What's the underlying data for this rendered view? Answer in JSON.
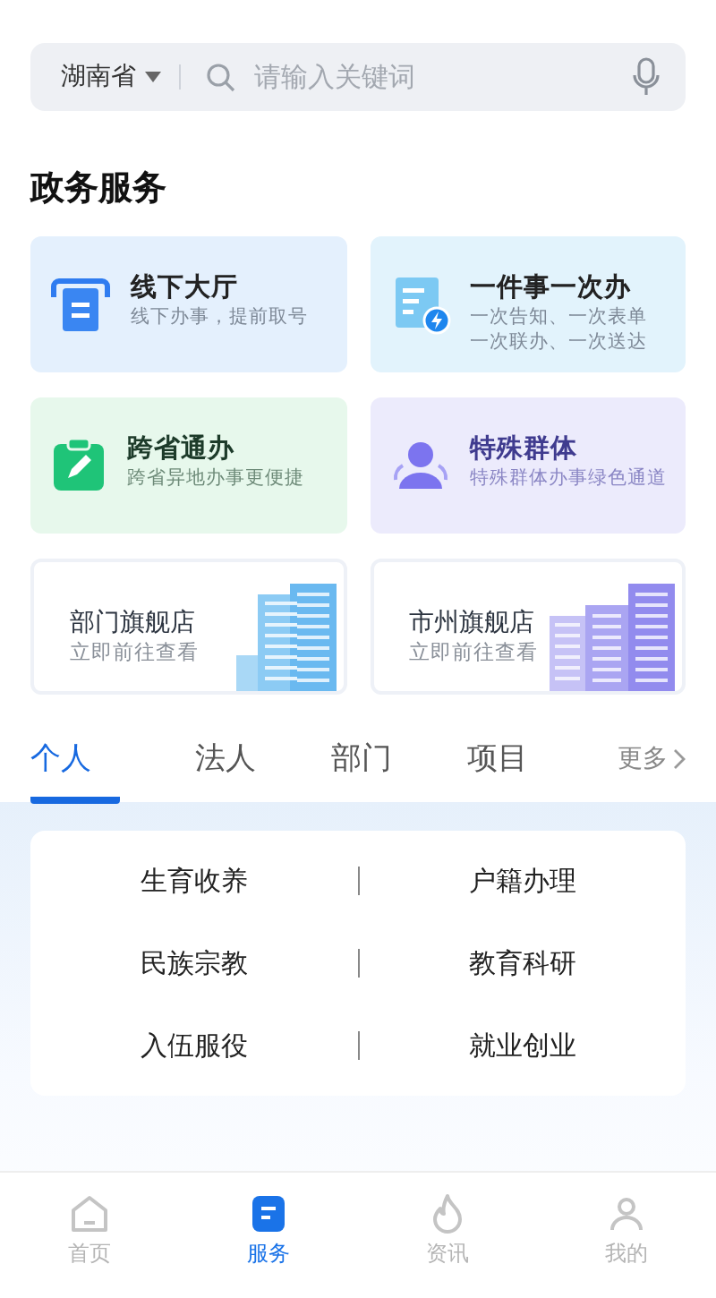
{
  "search": {
    "region": "湖南省",
    "placeholder": "请输入关键词"
  },
  "section_title": "政务服务",
  "service_cards": [
    {
      "kind": "counter",
      "title": "线下大厅",
      "lines": [
        "线下办事，提前取号"
      ]
    },
    {
      "kind": "once",
      "title": "一件事一次办",
      "lines": [
        "一次告知、一次表单",
        "一次联办、一次送达"
      ]
    },
    {
      "kind": "cross",
      "title": "跨省通办",
      "lines": [
        "跨省异地办事更便捷"
      ]
    },
    {
      "kind": "group",
      "title": "特殊群体",
      "lines": [
        "特殊群体办事绿色通道"
      ]
    }
  ],
  "store_cards": [
    {
      "kind": "department",
      "title": "部门旗舰店",
      "subtitle": "立即前往查看"
    },
    {
      "kind": "city",
      "title": "市州旗舰店",
      "subtitle": "立即前往查看"
    }
  ],
  "category_tabs": [
    {
      "label": "个人",
      "selected": true
    },
    {
      "label": "法人",
      "selected": false
    },
    {
      "label": "部门",
      "selected": false
    },
    {
      "label": "项目",
      "selected": false
    }
  ],
  "more_link": "更多",
  "topics": [
    "生育收养",
    "户籍办理",
    "民族宗教",
    "教育科研",
    "入伍服役",
    "就业创业"
  ],
  "bottom_nav": [
    {
      "kind": "home",
      "label": "首页",
      "selected": false
    },
    {
      "kind": "service",
      "label": "服务",
      "selected": true
    },
    {
      "kind": "news",
      "label": "资讯",
      "selected": false
    },
    {
      "kind": "me",
      "label": "我的",
      "selected": false
    }
  ]
}
